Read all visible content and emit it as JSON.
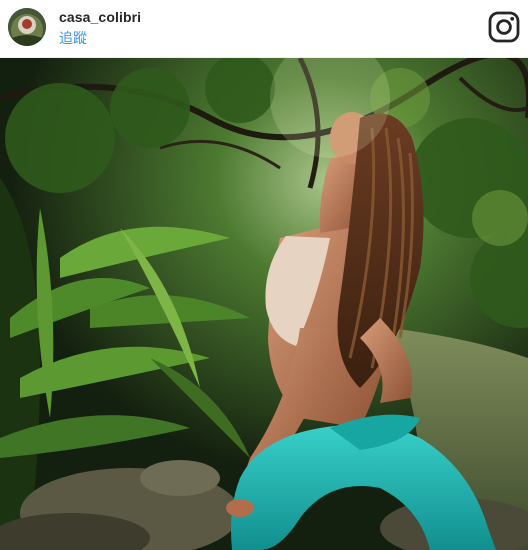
{
  "post": {
    "username": "casa_colibri",
    "follow_label": "追蹤"
  },
  "icons": {
    "brand": "instagram-logo-icon"
  },
  "colors": {
    "username": "#262626",
    "follow": "#3897f0",
    "leggings": "#1fb3b0",
    "foliage": "#2f5a1c"
  }
}
